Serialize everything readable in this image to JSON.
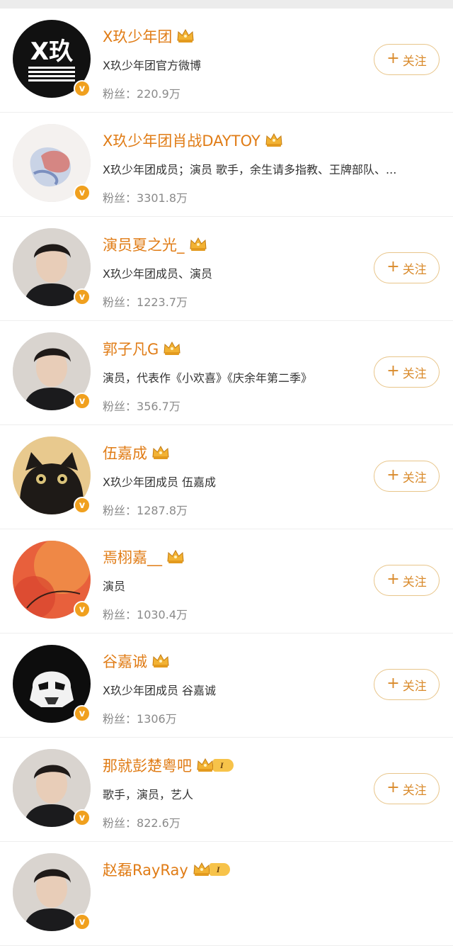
{
  "follow_label": "关注",
  "fans_prefix": "粉丝：",
  "colors": {
    "name": "#e07c16",
    "verified": "#f0a01e",
    "follow_border": "#e8c58a",
    "follow_text": "#d98a2b",
    "level_badge": "#f7c34a"
  },
  "users": [
    {
      "name": "X玖少年团",
      "desc": "X玖少年团官方微博",
      "fans": "220.9万",
      "crown": "crown-icon",
      "level": "",
      "follow_visible": true,
      "avatar": "x9-logo-avatar"
    },
    {
      "name": "X玖少年团肖战DAYTOY",
      "desc": "X玖少年团成员；演员 歌手，余生请多指教、王牌部队、...",
      "fans": "3301.8万",
      "crown": "crown-icon",
      "level": "",
      "follow_visible": false,
      "avatar": "painted-heart-avatar"
    },
    {
      "name": "演员夏之光_",
      "desc": "X玖少年团成员、演员",
      "fans": "1223.7万",
      "crown": "crown-icon",
      "level": "",
      "follow_visible": true,
      "avatar": "portrait-avatar"
    },
    {
      "name": "郭子凡G",
      "desc": "演员，代表作《小欢喜》《庆余年第二季》",
      "fans": "356.7万",
      "crown": "crown-icon",
      "level": "",
      "follow_visible": true,
      "avatar": "portrait-avatar"
    },
    {
      "name": "伍嘉成",
      "desc": "X玖少年团成员 伍嘉成",
      "fans": "1287.8万",
      "crown": "crown-icon",
      "level": "",
      "follow_visible": true,
      "avatar": "black-cat-avatar"
    },
    {
      "name": "焉栩嘉__",
      "desc": "演员",
      "fans": "1030.4万",
      "crown": "crown-icon",
      "level": "",
      "follow_visible": true,
      "avatar": "red-painting-avatar"
    },
    {
      "name": "谷嘉诚",
      "desc": "X玖少年团成员 谷嘉诚",
      "fans": "1306万",
      "crown": "crown-icon",
      "level": "",
      "follow_visible": true,
      "avatar": "stormtrooper-avatar"
    },
    {
      "name": "那就彭楚粤吧",
      "desc": "歌手，演员，艺人",
      "fans": "822.6万",
      "crown": "crown-icon",
      "level": "I",
      "follow_visible": true,
      "avatar": "portrait-avatar"
    },
    {
      "name": "赵磊RayRay",
      "desc": "",
      "fans": "",
      "crown": "crown-icon",
      "level": "I",
      "follow_visible": false,
      "avatar": "portrait-avatar"
    }
  ]
}
